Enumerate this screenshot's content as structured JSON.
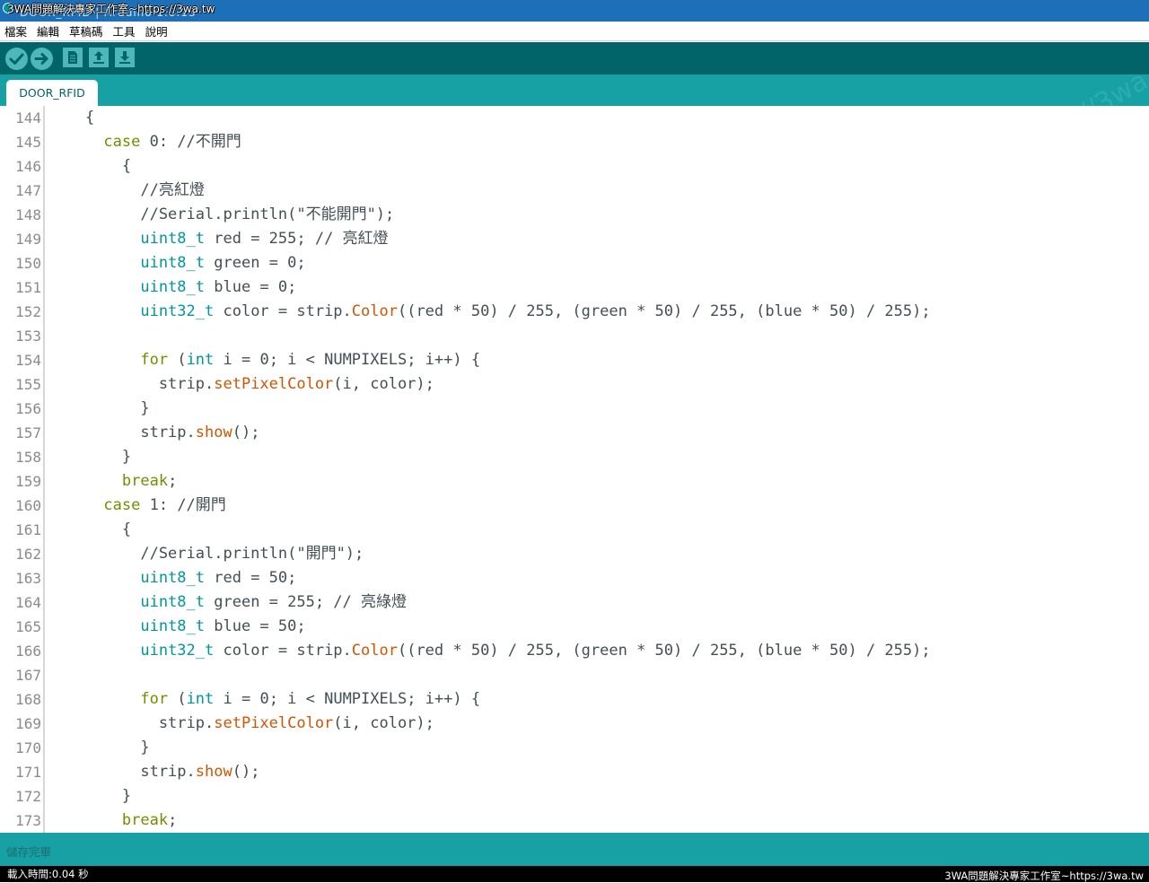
{
  "window": {
    "title_ghost": "DOOR_RFID | Arduino 1.8.13",
    "watermark": "3WA問題解決專家工作室~https://3wa.tw"
  },
  "menu": [
    "檔案",
    "編輯",
    "草稿碼",
    "工具",
    "說明"
  ],
  "toolbar": {
    "buttons": [
      "verify-icon",
      "upload-icon",
      "new-icon",
      "open-icon",
      "save-icon"
    ]
  },
  "tabs": [
    {
      "label": "DOOR_RFID"
    }
  ],
  "tab_watermark": "://3wa",
  "editor": {
    "lines": [
      {
        "n": "144",
        "segs": [
          {
            "t": "    {",
            "c": "tx"
          }
        ]
      },
      {
        "n": "145",
        "segs": [
          {
            "t": "      ",
            "c": "tx"
          },
          {
            "t": "case",
            "c": "kw-case"
          },
          {
            "t": " 0: //不開門",
            "c": "tx"
          }
        ]
      },
      {
        "n": "146",
        "segs": [
          {
            "t": "        {",
            "c": "tx"
          }
        ]
      },
      {
        "n": "147",
        "segs": [
          {
            "t": "          //亮紅燈",
            "c": "cm"
          }
        ]
      },
      {
        "n": "148",
        "segs": [
          {
            "t": "          //Serial.println(\"不能開門\");",
            "c": "cm"
          }
        ]
      },
      {
        "n": "149",
        "segs": [
          {
            "t": "          ",
            "c": "tx"
          },
          {
            "t": "uint8_t",
            "c": "ty"
          },
          {
            "t": " red = 255; // 亮紅燈",
            "c": "tx"
          }
        ]
      },
      {
        "n": "150",
        "segs": [
          {
            "t": "          ",
            "c": "tx"
          },
          {
            "t": "uint8_t",
            "c": "ty"
          },
          {
            "t": " green = 0;",
            "c": "tx"
          }
        ]
      },
      {
        "n": "151",
        "segs": [
          {
            "t": "          ",
            "c": "tx"
          },
          {
            "t": "uint8_t",
            "c": "ty"
          },
          {
            "t": " blue = 0;",
            "c": "tx"
          }
        ]
      },
      {
        "n": "152",
        "segs": [
          {
            "t": "          ",
            "c": "tx"
          },
          {
            "t": "uint32_t",
            "c": "ty"
          },
          {
            "t": " color = strip.",
            "c": "tx"
          },
          {
            "t": "Color",
            "c": "fn"
          },
          {
            "t": "((red * 50) / 255, (green * 50) / 255, (blue * 50) / 255);",
            "c": "tx"
          }
        ]
      },
      {
        "n": "153",
        "segs": []
      },
      {
        "n": "154",
        "segs": [
          {
            "t": "          ",
            "c": "tx"
          },
          {
            "t": "for",
            "c": "kw-case"
          },
          {
            "t": " (",
            "c": "tx"
          },
          {
            "t": "int",
            "c": "ty"
          },
          {
            "t": " i = 0; i < NUMPIXELS; i++) {",
            "c": "tx"
          }
        ]
      },
      {
        "n": "155",
        "segs": [
          {
            "t": "            strip.",
            "c": "tx"
          },
          {
            "t": "setPixelColor",
            "c": "fn"
          },
          {
            "t": "(i, color);",
            "c": "tx"
          }
        ]
      },
      {
        "n": "156",
        "segs": [
          {
            "t": "          }",
            "c": "tx"
          }
        ]
      },
      {
        "n": "157",
        "segs": [
          {
            "t": "          strip.",
            "c": "tx"
          },
          {
            "t": "show",
            "c": "fn"
          },
          {
            "t": "();",
            "c": "tx"
          }
        ]
      },
      {
        "n": "158",
        "segs": [
          {
            "t": "        }",
            "c": "tx"
          }
        ]
      },
      {
        "n": "159",
        "segs": [
          {
            "t": "        ",
            "c": "tx"
          },
          {
            "t": "break",
            "c": "kw-case"
          },
          {
            "t": ";",
            "c": "tx"
          }
        ]
      },
      {
        "n": "160",
        "segs": [
          {
            "t": "      ",
            "c": "tx"
          },
          {
            "t": "case",
            "c": "kw-case"
          },
          {
            "t": " 1: //開門",
            "c": "tx"
          }
        ]
      },
      {
        "n": "161",
        "segs": [
          {
            "t": "        {",
            "c": "tx"
          }
        ]
      },
      {
        "n": "162",
        "segs": [
          {
            "t": "          //Serial.println(\"開門\");",
            "c": "cm"
          }
        ]
      },
      {
        "n": "163",
        "segs": [
          {
            "t": "          ",
            "c": "tx"
          },
          {
            "t": "uint8_t",
            "c": "ty"
          },
          {
            "t": " red = 50;",
            "c": "tx"
          }
        ]
      },
      {
        "n": "164",
        "segs": [
          {
            "t": "          ",
            "c": "tx"
          },
          {
            "t": "uint8_t",
            "c": "ty"
          },
          {
            "t": " green = 255; // 亮綠燈",
            "c": "tx"
          }
        ]
      },
      {
        "n": "165",
        "segs": [
          {
            "t": "          ",
            "c": "tx"
          },
          {
            "t": "uint8_t",
            "c": "ty"
          },
          {
            "t": " blue = 50;",
            "c": "tx"
          }
        ]
      },
      {
        "n": "166",
        "segs": [
          {
            "t": "          ",
            "c": "tx"
          },
          {
            "t": "uint32_t",
            "c": "ty"
          },
          {
            "t": " color = strip.",
            "c": "tx"
          },
          {
            "t": "Color",
            "c": "fn"
          },
          {
            "t": "((red * 50) / 255, (green * 50) / 255, (blue * 50) / 255);",
            "c": "tx"
          }
        ]
      },
      {
        "n": "167",
        "segs": []
      },
      {
        "n": "168",
        "segs": [
          {
            "t": "          ",
            "c": "tx"
          },
          {
            "t": "for",
            "c": "kw-case"
          },
          {
            "t": " (",
            "c": "tx"
          },
          {
            "t": "int",
            "c": "ty"
          },
          {
            "t": " i = 0; i < NUMPIXELS; i++) {",
            "c": "tx"
          }
        ]
      },
      {
        "n": "169",
        "segs": [
          {
            "t": "            strip.",
            "c": "tx"
          },
          {
            "t": "setPixelColor",
            "c": "fn"
          },
          {
            "t": "(i, color);",
            "c": "tx"
          }
        ]
      },
      {
        "n": "170",
        "segs": [
          {
            "t": "          }",
            "c": "tx"
          }
        ]
      },
      {
        "n": "171",
        "segs": [
          {
            "t": "          strip.",
            "c": "tx"
          },
          {
            "t": "show",
            "c": "fn"
          },
          {
            "t": "();",
            "c": "tx"
          }
        ]
      },
      {
        "n": "172",
        "segs": [
          {
            "t": "        }",
            "c": "tx"
          }
        ]
      },
      {
        "n": "173",
        "segs": [
          {
            "t": "        ",
            "c": "tx"
          },
          {
            "t": "break",
            "c": "kw-case"
          },
          {
            "t": ";",
            "c": "tx"
          }
        ]
      }
    ]
  },
  "status": {
    "message": "儲存完畢",
    "console_text": "載入時間:0.04 秒"
  },
  "colors": {
    "titlebar": "#1d70b7",
    "toolbar": "#006468",
    "tabstrip": "#17a1a5",
    "keyword": "#728e00",
    "type": "#00979c",
    "function": "#d35400",
    "text": "#434f54"
  }
}
